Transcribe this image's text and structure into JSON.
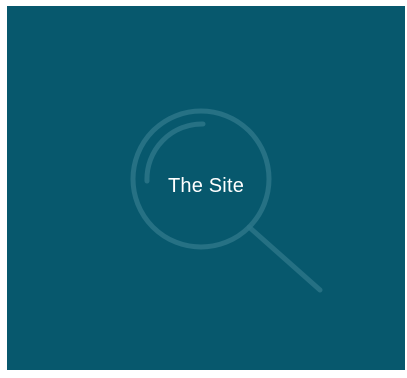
{
  "tile": {
    "title": "The Site",
    "icon": "magnifying-glass-icon",
    "colors": {
      "background": "#07586d",
      "icon_stroke": "#2f7a8d",
      "text": "#ffffff"
    }
  }
}
